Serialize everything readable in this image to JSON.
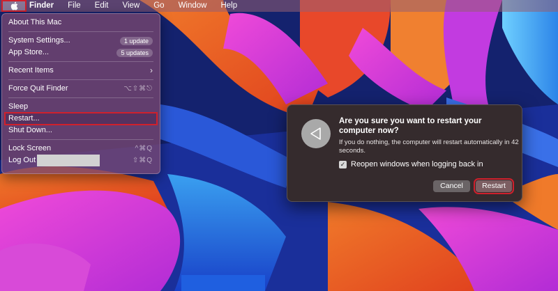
{
  "menubar": {
    "apple_icon": "apple-logo-icon",
    "items": [
      "Finder",
      "File",
      "Edit",
      "View",
      "Go",
      "Window",
      "Help"
    ]
  },
  "apple_menu": {
    "about": "About This Mac",
    "system_settings": "System Settings...",
    "system_settings_badge": "1 update",
    "app_store": "App Store...",
    "app_store_badge": "5 updates",
    "recent_items": "Recent Items",
    "force_quit": "Force Quit Finder",
    "force_quit_shortcut": "⌥⇧⌘⎋",
    "sleep": "Sleep",
    "restart": "Restart...",
    "shut_down": "Shut Down...",
    "lock_screen": "Lock Screen",
    "lock_screen_shortcut": "^⌘Q",
    "log_out": "Log Out",
    "log_out_shortcut": "⇧⌘Q"
  },
  "dialog": {
    "icon": "restart-triangle-icon",
    "title": "Are you sure you want to restart your computer now?",
    "message": "If you do nothing, the computer will restart automatically in 42 seconds.",
    "checkbox_label": "Reopen windows when logging back in",
    "checkbox_checked": true,
    "cancel_label": "Cancel",
    "restart_label": "Restart"
  },
  "colors": {
    "highlight": "#d0202c",
    "dialog_bg": "#352b2d"
  }
}
